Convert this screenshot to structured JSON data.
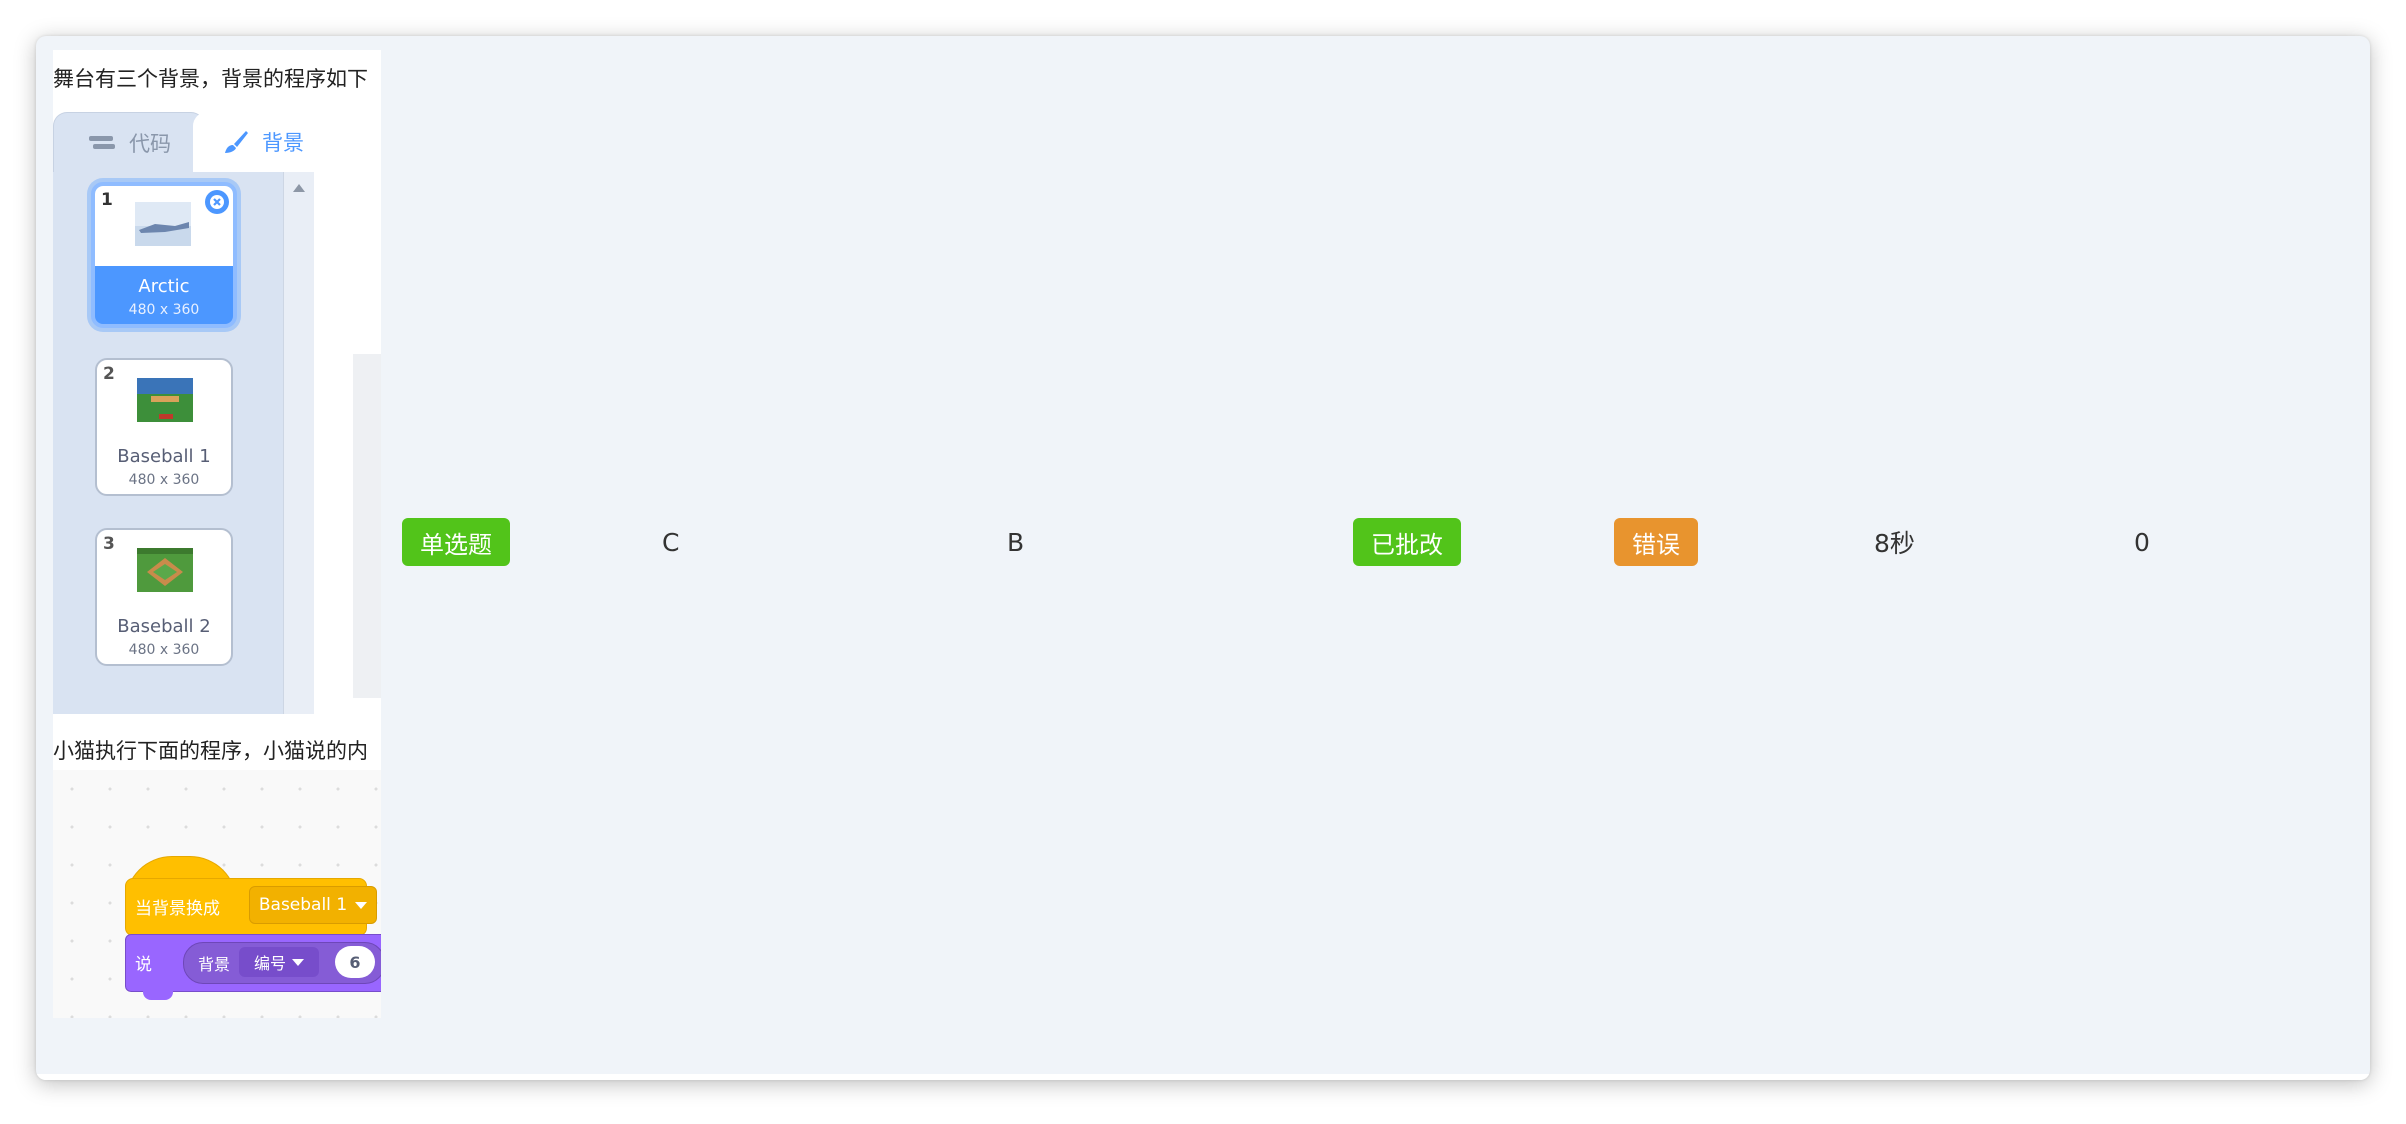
{
  "question": {
    "text_1": "舞台有三个背景，背景的程序如下",
    "text_2": "小猫执行下面的程序，小猫说的内",
    "tabs": {
      "code": "代码",
      "backdrop": "背景"
    },
    "backdrops": [
      {
        "num": "1",
        "name": "Arctic",
        "size": "480 x 360",
        "selected": true
      },
      {
        "num": "2",
        "name": "Baseball 1",
        "size": "480 x 360",
        "selected": false
      },
      {
        "num": "3",
        "name": "Baseball 2",
        "size": "480 x 360",
        "selected": false
      }
    ],
    "blocks": {
      "hat_label": "当背景换成",
      "hat_value": "Baseball 1",
      "say_label": "说",
      "reporter_label": "背景",
      "reporter_value": "编号",
      "number": "6"
    }
  },
  "row": {
    "type_tag": "单选题",
    "correct_answer": "C",
    "student_answer": "B",
    "review_status": "已批改",
    "result": "错误",
    "time_spent": "8秒",
    "score": "0"
  },
  "colors": {
    "green_tag": "#52c41a",
    "orange_tag": "#e8942e",
    "scratch_blue": "#4c97ff",
    "events_yellow": "#ffbf00",
    "looks_purple": "#9966ff"
  }
}
